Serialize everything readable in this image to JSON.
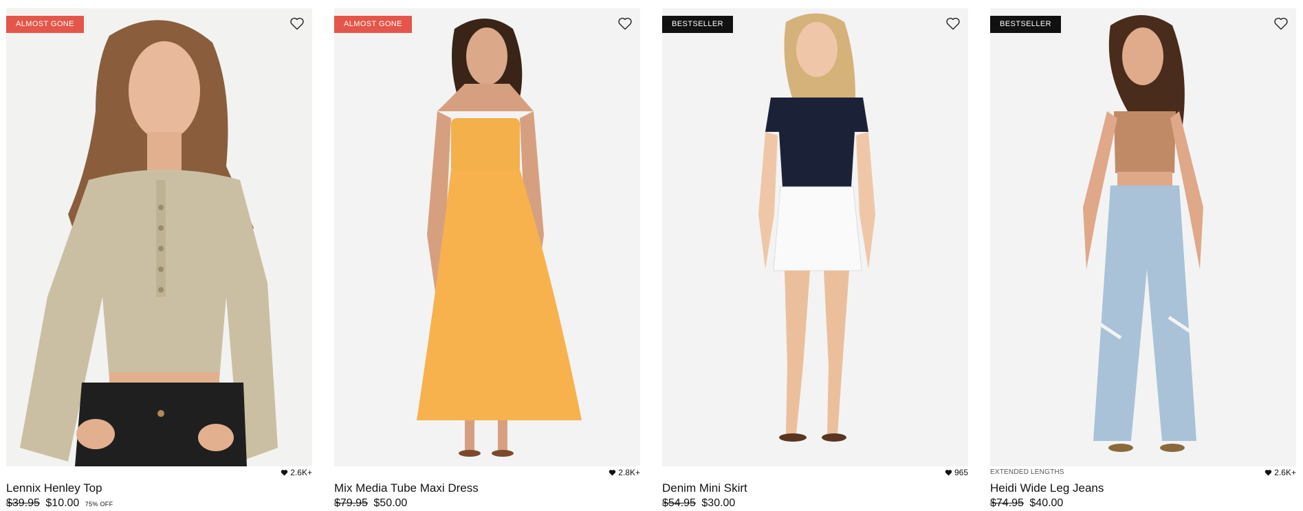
{
  "products": [
    {
      "badge": "ALMOST GONE",
      "badge_color": "#e4564a",
      "tagline": "",
      "likes": "2.6K+",
      "name": "Lennix Henley Top",
      "price_old": "$39.95",
      "price_new": "$10.00",
      "discount": "75% OFF"
    },
    {
      "badge": "ALMOST GONE",
      "badge_color": "#e4564a",
      "tagline": "",
      "likes": "2.8K+",
      "name": "Mix Media Tube Maxi Dress",
      "price_old": "$79.95",
      "price_new": "$50.00",
      "discount": ""
    },
    {
      "badge": "BESTSELLER",
      "badge_color": "#111111",
      "tagline": "",
      "likes": "965",
      "name": "Denim Mini Skirt",
      "price_old": "$54.95",
      "price_new": "$30.00",
      "discount": ""
    },
    {
      "badge": "BESTSELLER",
      "badge_color": "#111111",
      "tagline": "EXTENDED LENGTHS",
      "likes": "2.6K+",
      "name": "Heidi Wide Leg Jeans",
      "price_old": "$74.95",
      "price_new": "$40.00",
      "discount": ""
    }
  ],
  "icons": {
    "wishlist": "heart-outline-icon",
    "likes": "heart-filled-icon"
  }
}
